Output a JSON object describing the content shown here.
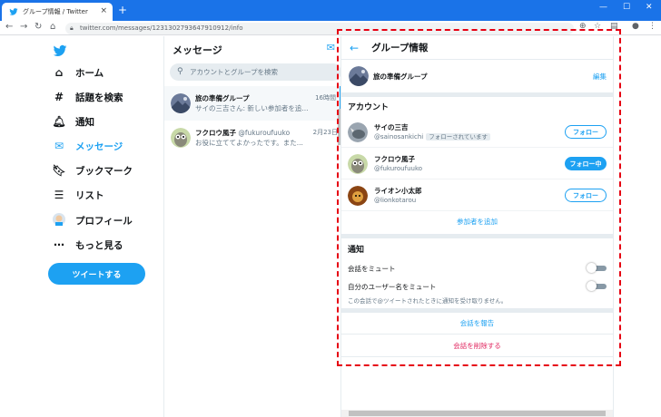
{
  "browser": {
    "tab_title": "グループ情報 / Twitter",
    "tab_close": "×",
    "new_tab": "+",
    "url": "twitter.com/messages/1231302793647910912/info",
    "win_min": "—",
    "win_max": "☐",
    "win_close": "✕"
  },
  "leftnav": {
    "items": [
      {
        "label": "ホーム",
        "icon": "home-icon",
        "glyph": "⌂"
      },
      {
        "label": "話題を検索",
        "icon": "hashtag-icon",
        "glyph": "#"
      },
      {
        "label": "通知",
        "icon": "bell-icon",
        "glyph": "🔔︎"
      },
      {
        "label": "メッセージ",
        "icon": "mail-icon",
        "glyph": "✉"
      },
      {
        "label": "ブックマーク",
        "icon": "bookmark-icon",
        "glyph": "🔖︎"
      },
      {
        "label": "リスト",
        "icon": "list-icon",
        "glyph": "☰"
      },
      {
        "label": "プロフィール",
        "icon": "profile-avatar",
        "glyph": "●"
      },
      {
        "label": "もっと見る",
        "icon": "more-icon",
        "glyph": "⋯"
      }
    ],
    "tweet_button": "ツイートする"
  },
  "messages": {
    "title": "メッセージ",
    "search_placeholder": "アカウントとグループを検索",
    "conversations": [
      {
        "name": "旅の準備グループ",
        "handle": "",
        "time": "16時間",
        "preview": "サイの三吉さん: 新しい参加者を追..."
      },
      {
        "name": "フクロウ風子",
        "handle": "@fukuroufuuko",
        "time": "2月23日",
        "preview": "お役に立ててよかったです。また..."
      }
    ]
  },
  "panel": {
    "title": "グループ情報",
    "group_name": "旅の準備グループ",
    "edit": "編集",
    "accounts_title": "アカウント",
    "members": [
      {
        "name": "サイの三吉",
        "handle": "@sainosankichi",
        "badge": "フォローされています",
        "button": "フォロー",
        "style": "outline"
      },
      {
        "name": "フクロウ風子",
        "handle": "@fukuroufuuko",
        "badge": "",
        "button": "フォロー中",
        "style": "solid"
      },
      {
        "name": "ライオン小太郎",
        "handle": "@lionkotarou",
        "badge": "",
        "button": "フォロー",
        "style": "outline"
      }
    ],
    "add_member": "参加者を追加",
    "notifications_title": "通知",
    "mute_conversation": "会話をミュート",
    "mute_username": "自分のユーザー名をミュート",
    "mute_note": "この会話で@ツイートされたときに通知を受け取りません。",
    "report": "会話を報告",
    "delete": "会話を削除する"
  },
  "colors": {
    "accent": "#1da1f2",
    "danger": "#e0245e",
    "highlight": "#e60012"
  }
}
